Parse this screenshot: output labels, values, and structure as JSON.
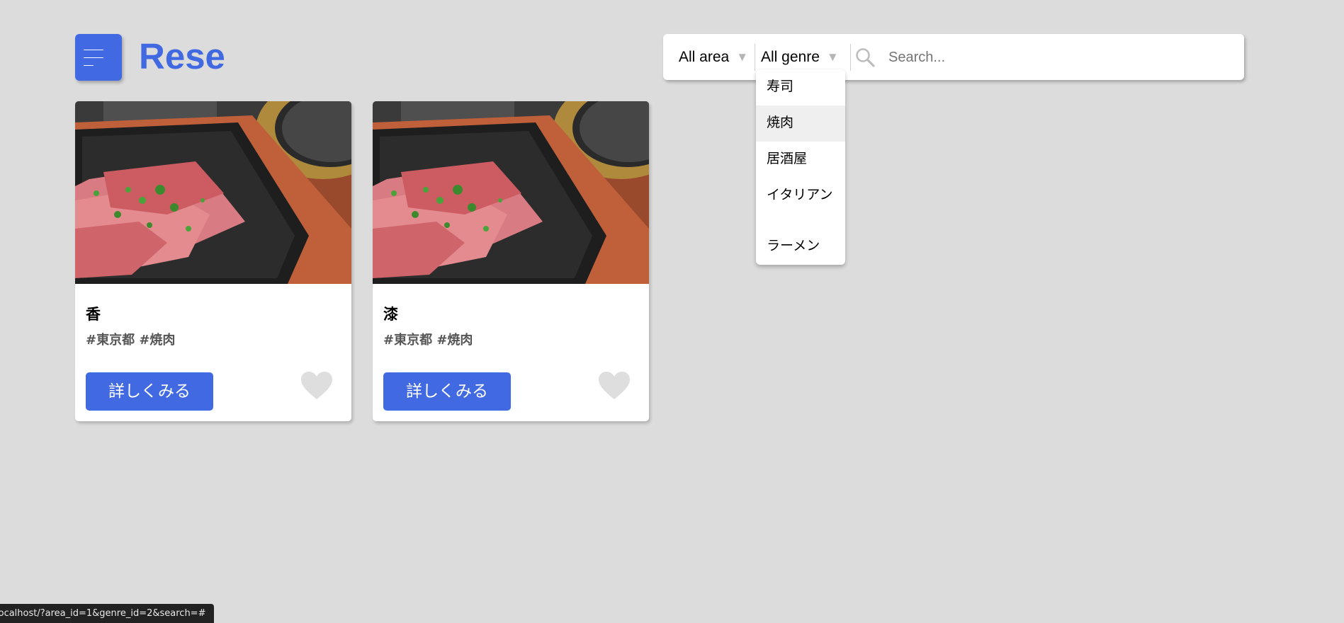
{
  "app": {
    "logo": "Rese",
    "brand_color": "#4169e1",
    "background_color": "#dcdcdc"
  },
  "header": {
    "menu_icon": "hamburger-menu-icon"
  },
  "search": {
    "area_label": "All area",
    "genre_label": "All genre",
    "select_arrow_icon": "triangle-down-icon",
    "search_icon": "magnifier-icon",
    "placeholder": "Search...",
    "value": ""
  },
  "genre_dropdown": {
    "options": [
      "寿司",
      "焼肉",
      "居酒屋",
      "イタリアン",
      "ラーメン"
    ],
    "hovered_index": 1
  },
  "shops": [
    {
      "name": "香",
      "tags": "#東京都 #焼肉",
      "detail_button": "詳しくみる",
      "favorite_icon": "heart-icon",
      "favorite": false,
      "image": "yakiniku-meat-on-grill-photo"
    },
    {
      "name": "漆",
      "tags": "#東京都 #焼肉",
      "detail_button": "詳しくみる",
      "favorite_icon": "heart-icon",
      "favorite": false,
      "image": "yakiniku-meat-on-grill-photo"
    }
  ],
  "status_bar": {
    "url": "localhost/?area_id=1&genre_id=2&search=#"
  }
}
